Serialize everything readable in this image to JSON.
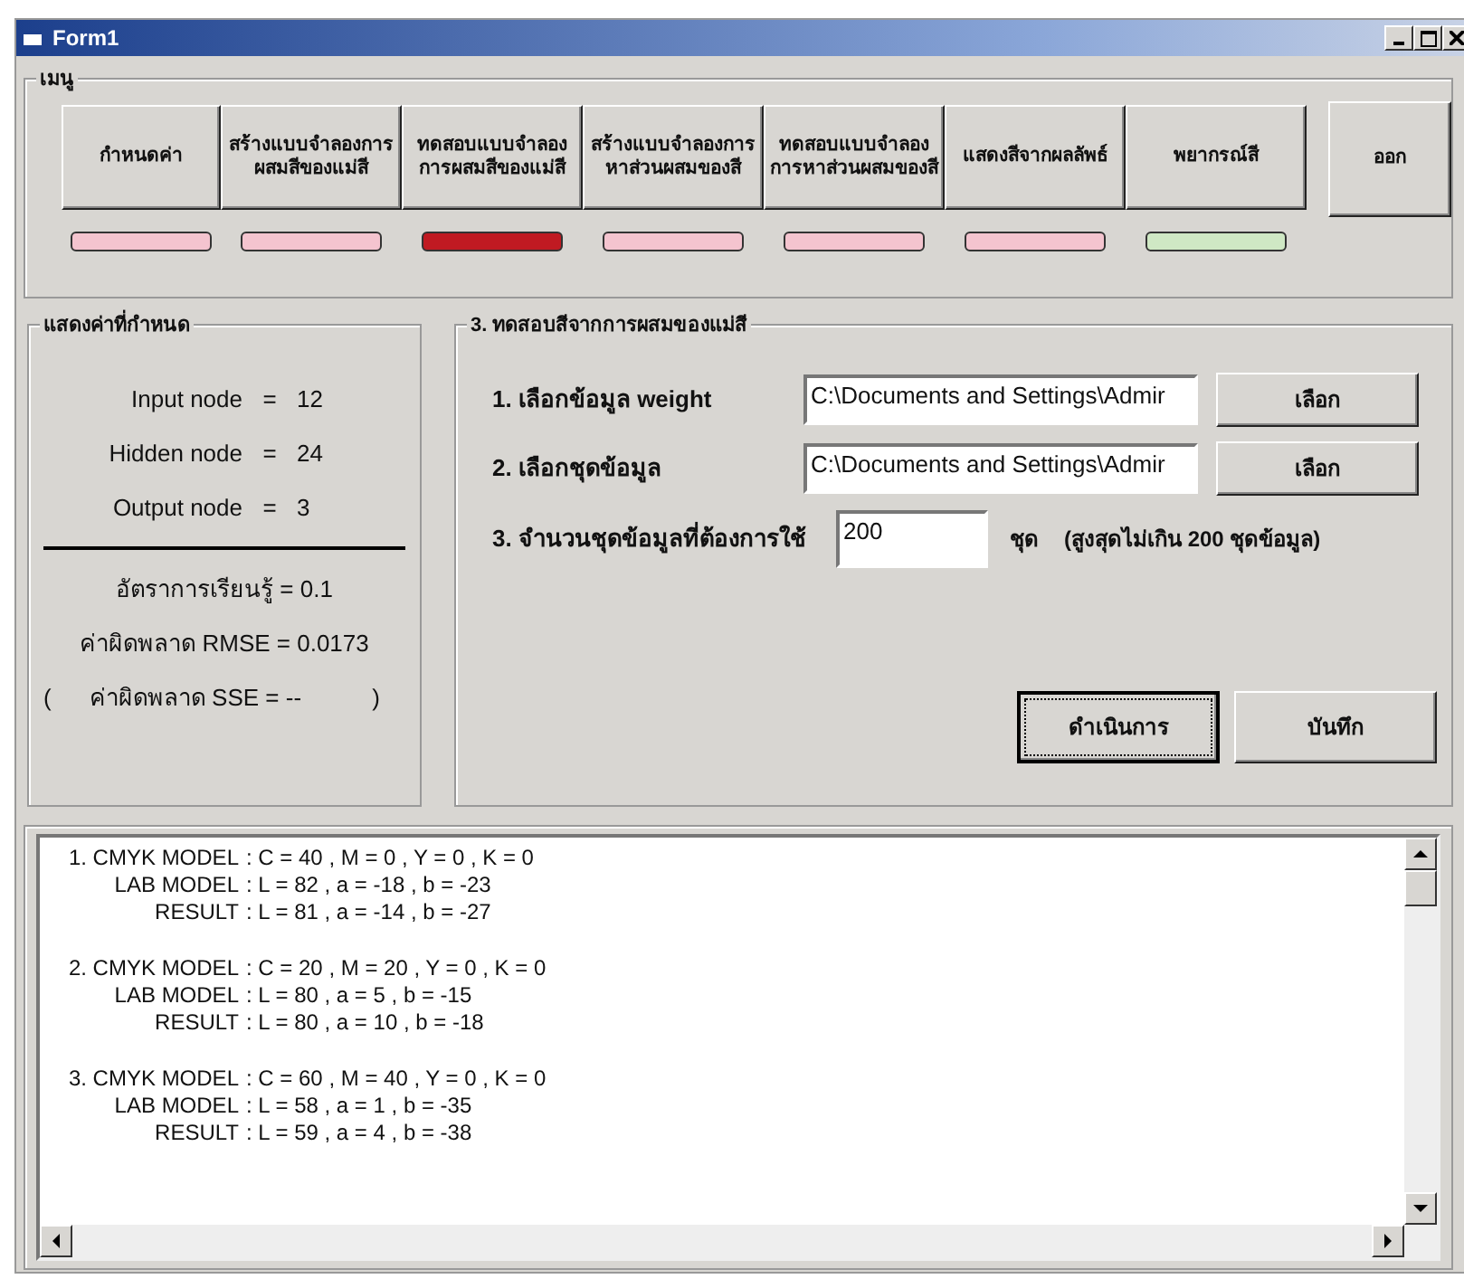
{
  "window": {
    "title": "Form1"
  },
  "menu": {
    "title": "เมนู",
    "items": [
      {
        "label": "กำหนดค่า",
        "color": "#f4c4cf"
      },
      {
        "label": "สร้างแบบจำลองการผสมสีของแม่สี",
        "color": "#f4c4cf"
      },
      {
        "label": "ทดสอบแบบจำลองการผสมสีของแม่สี",
        "color": "#c01a22"
      },
      {
        "label": "สร้างแบบจำลองการหาส่วนผสมของสี",
        "color": "#f4c4cf"
      },
      {
        "label": "ทดสอบแบบจำลองการหาส่วนผสมของสี",
        "color": "#f4c4cf"
      },
      {
        "label": "แสดงสีจากผลลัพธ์",
        "color": "#f4c4cf"
      },
      {
        "label": "พยากรณ์สี",
        "color": "#cfe8c4"
      }
    ],
    "exit_button": "ออก"
  },
  "settings": {
    "title": "แสดงค่าที่กำหนด",
    "nodes": [
      {
        "label": "Input node",
        "eq": "=",
        "value": "12"
      },
      {
        "label": "Hidden node",
        "eq": "=",
        "value": "24"
      },
      {
        "label": "Output node",
        "eq": "=",
        "value": "3"
      }
    ],
    "metrics": [
      "อัตราการเรียนรู้ = 0.1",
      "ค่าผิดพลาด RMSE = 0.0173"
    ],
    "sse": {
      "open": "(",
      "text": "ค่าผิดพลาด SSE = --",
      "close": ")"
    }
  },
  "test": {
    "title": "3. ทดสอบสีจากการผสมของแม่สี",
    "weight": {
      "label": "1. เลือกข้อมูล weight",
      "value": "C:\\Documents and Settings\\Admir",
      "button": "เลือก"
    },
    "dataset": {
      "label": "2. เลือกชุดข้อมูล",
      "value": "C:\\Documents and Settings\\Admir",
      "button": "เลือก"
    },
    "count": {
      "label": "3. จำนวนชุดข้อมูลที่ต้องการใช้",
      "value": "200",
      "unit": "ชุด",
      "note": "(สูงสุดไม่เกิน 200 ชุดข้อมูล)"
    },
    "buttons": [
      {
        "label": "ดำเนินการ",
        "focused": true
      },
      {
        "label": "บันทึก",
        "focused": false
      }
    ]
  },
  "results": [
    [
      {
        "label": "1. CMYK MODEL",
        "value": ":  C = 40 , M = 0 , Y = 0 , K = 0"
      },
      {
        "label": "LAB MODEL",
        "value": ":  L = 82 , a = -18 , b = -23"
      },
      {
        "label": "RESULT",
        "value": ":  L = 81 , a = -14 , b = -27"
      }
    ],
    [
      {
        "label": "2. CMYK MODEL",
        "value": ":  C = 20 , M = 20 , Y = 0 , K = 0"
      },
      {
        "label": "LAB MODEL",
        "value": ":  L = 80 , a = 5 , b = -15"
      },
      {
        "label": "RESULT",
        "value": ":  L = 80 , a = 10 , b = -18"
      }
    ],
    [
      {
        "label": "3. CMYK MODEL",
        "value": ":  C = 60 , M = 40 , Y = 0 , K = 0"
      },
      {
        "label": "LAB MODEL",
        "value": ":  L = 58 , a = 1 , b = -35"
      },
      {
        "label": "RESULT",
        "value": ":  L = 59 , a = 4 , b = -38"
      }
    ]
  ]
}
